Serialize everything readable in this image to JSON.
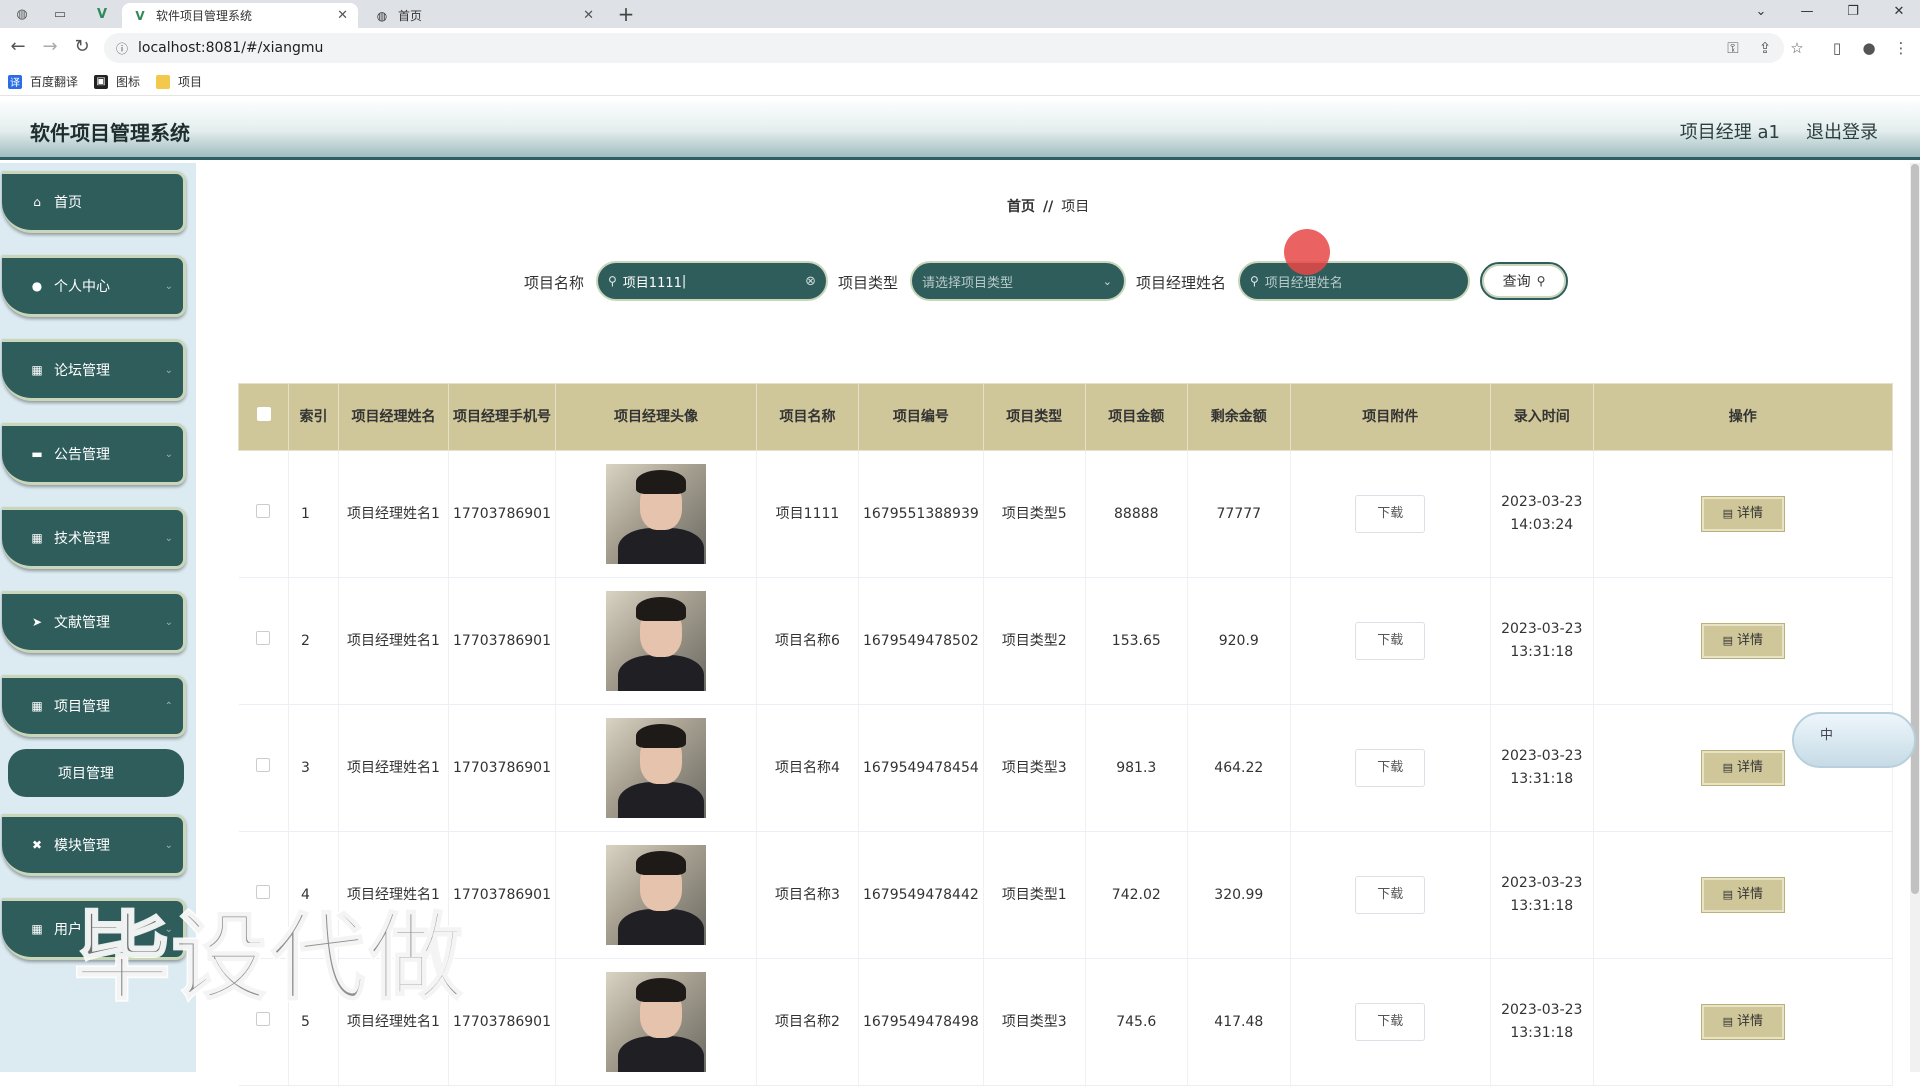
{
  "browser": {
    "tabs": [
      {
        "title": "软件项目管理系统",
        "active": true
      },
      {
        "title": "首页",
        "active": false
      }
    ],
    "url": "localhost:8081/#/xiangmu",
    "bookmarks": [
      {
        "label": "百度翻译"
      },
      {
        "label": "图标"
      },
      {
        "label": "项目"
      }
    ]
  },
  "header": {
    "title": "软件项目管理系统",
    "user": "项目经理 a1",
    "logout": "退出登录"
  },
  "sidebar": {
    "items": [
      {
        "label": "首页",
        "icon": "home-icon"
      },
      {
        "label": "个人中心",
        "icon": "user-icon"
      },
      {
        "label": "论坛管理",
        "icon": "grid-icon"
      },
      {
        "label": "公告管理",
        "icon": "monitor-icon"
      },
      {
        "label": "技术管理",
        "icon": "grid-icon"
      },
      {
        "label": "文献管理",
        "icon": "send-icon"
      },
      {
        "label": "项目管理",
        "icon": "grid-icon"
      },
      {
        "label": "模块管理",
        "icon": "ticket-icon"
      },
      {
        "label": "用户",
        "icon": "grid-icon"
      }
    ],
    "submenu": {
      "label": "项目管理"
    }
  },
  "breadcrumb": {
    "home": "首页",
    "sep": "//",
    "current": "项目"
  },
  "search": {
    "name_label": "项目名称",
    "name_value": "项目1111",
    "type_label": "项目类型",
    "type_placeholder": "请选择项目类型",
    "manager_label": "项目经理姓名",
    "manager_placeholder": "项目经理姓名",
    "query_label": "查询"
  },
  "table": {
    "headers": [
      "索引",
      "项目经理姓名",
      "项目经理手机号",
      "项目经理头像",
      "项目名称",
      "项目编号",
      "项目类型",
      "项目金额",
      "剩余金额",
      "项目附件",
      "录入时间",
      "操作"
    ],
    "download_label": "下载",
    "detail_label": "详情",
    "rows": [
      {
        "index": "1",
        "manager": "项目经理姓名1",
        "phone": "17703786901",
        "name": "项目1111",
        "code": "1679551388939",
        "type": "项目类型5",
        "amount": "88888",
        "remaining": "77777",
        "date": "2023-03-23",
        "time": "14:03:24"
      },
      {
        "index": "2",
        "manager": "项目经理姓名1",
        "phone": "17703786901",
        "name": "项目名称6",
        "code": "1679549478502",
        "type": "项目类型2",
        "amount": "153.65",
        "remaining": "920.9",
        "date": "2023-03-23",
        "time": "13:31:18"
      },
      {
        "index": "3",
        "manager": "项目经理姓名1",
        "phone": "17703786901",
        "name": "项目名称4",
        "code": "1679549478454",
        "type": "项目类型3",
        "amount": "981.3",
        "remaining": "464.22",
        "date": "2023-03-23",
        "time": "13:31:18"
      },
      {
        "index": "4",
        "manager": "项目经理姓名1",
        "phone": "17703786901",
        "name": "项目名称3",
        "code": "1679549478442",
        "type": "项目类型1",
        "amount": "742.02",
        "remaining": "320.99",
        "date": "2023-03-23",
        "time": "13:31:18"
      },
      {
        "index": "5",
        "manager": "项目经理姓名1",
        "phone": "17703786901",
        "name": "项目名称2",
        "code": "1679549478498",
        "type": "项目类型3",
        "amount": "745.6",
        "remaining": "417.48",
        "date": "2023-03-23",
        "time": "13:31:18"
      }
    ]
  },
  "widget": {
    "label": "中"
  },
  "watermark": "毕设代做",
  "colors": {
    "accent": "#2e5d5c",
    "table_header": "#cfc79a",
    "sidebar_bg": "#dcebf2"
  }
}
